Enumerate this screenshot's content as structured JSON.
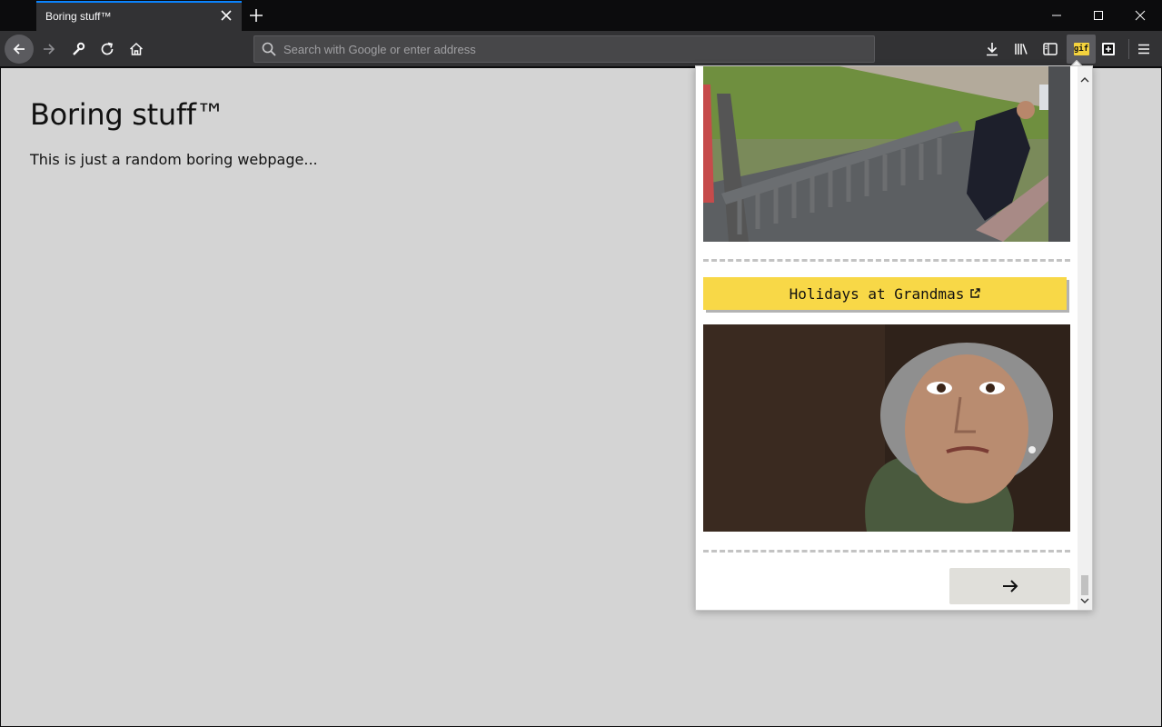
{
  "window": {
    "tab_title": "Boring stuff™"
  },
  "toolbar": {
    "url_placeholder": "Search with Google or enter address",
    "gif_label": "gif"
  },
  "page": {
    "title": "Boring stuff™",
    "text": "This is just a random boring webpage..."
  },
  "popup": {
    "link_label": "Holidays at Grandmas",
    "next_icon": "arrow-right-icon"
  },
  "colors": {
    "accent": "#0a84ff",
    "button_yellow": "#f8d847",
    "page_bg": "#d4d4d4"
  }
}
